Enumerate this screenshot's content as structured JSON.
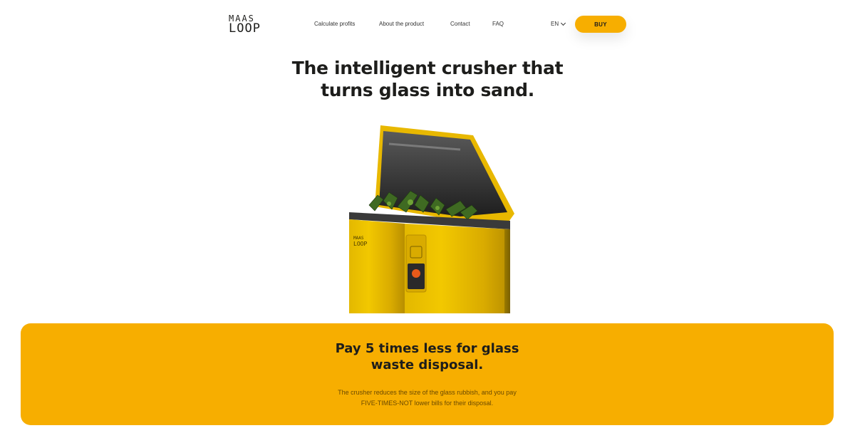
{
  "brand": {
    "logo_top": "MAAS",
    "logo_bottom": "LOOP"
  },
  "nav": {
    "items": [
      "Calculate profits",
      "About the product",
      "Contact",
      "FAQ"
    ],
    "language": "EN",
    "buy_label": "BUY"
  },
  "hero": {
    "title_line1": "The intelligent crusher that",
    "title_line2": "turns glass into sand.",
    "product_logo": "MAAS LOOP"
  },
  "banner": {
    "title_line1": "Pay 5 times less for glass",
    "title_line2": "waste disposal.",
    "text_line1": "The crusher reduces the size of the glass rubbish, and you pay",
    "text_line2": "FIVE-TIMES-NOT lower bills for their disposal."
  },
  "colors": {
    "accent": "#f7ae00",
    "text": "#1d1d1b",
    "background": "#ffffff"
  }
}
